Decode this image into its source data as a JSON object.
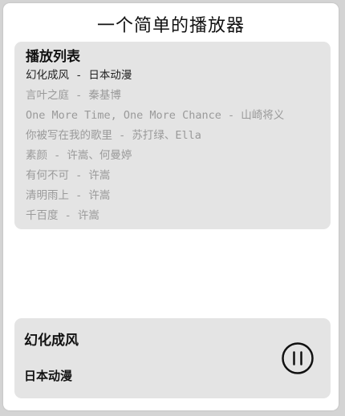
{
  "app": {
    "title": "一个简单的播放器"
  },
  "playlist": {
    "heading": "播放列表",
    "tracks": [
      {
        "label": "幻化成风 - 日本动漫",
        "active": true
      },
      {
        "label": "言叶之庭 - 秦基博",
        "active": false
      },
      {
        "label": "One More Time, One More Chance - 山崎将义",
        "active": false
      },
      {
        "label": "你被写在我的歌里 - 苏打绿、Ella",
        "active": false
      },
      {
        "label": "素颜 - 许嵩、何曼婷",
        "active": false
      },
      {
        "label": "有何不可 - 许嵩",
        "active": false
      },
      {
        "label": "清明雨上 - 许嵩",
        "active": false
      },
      {
        "label": "千百度 - 许嵩",
        "active": false
      }
    ]
  },
  "now_playing": {
    "title": "幻化成风",
    "artist": "日本动漫",
    "control_icon": "pause-icon"
  }
}
